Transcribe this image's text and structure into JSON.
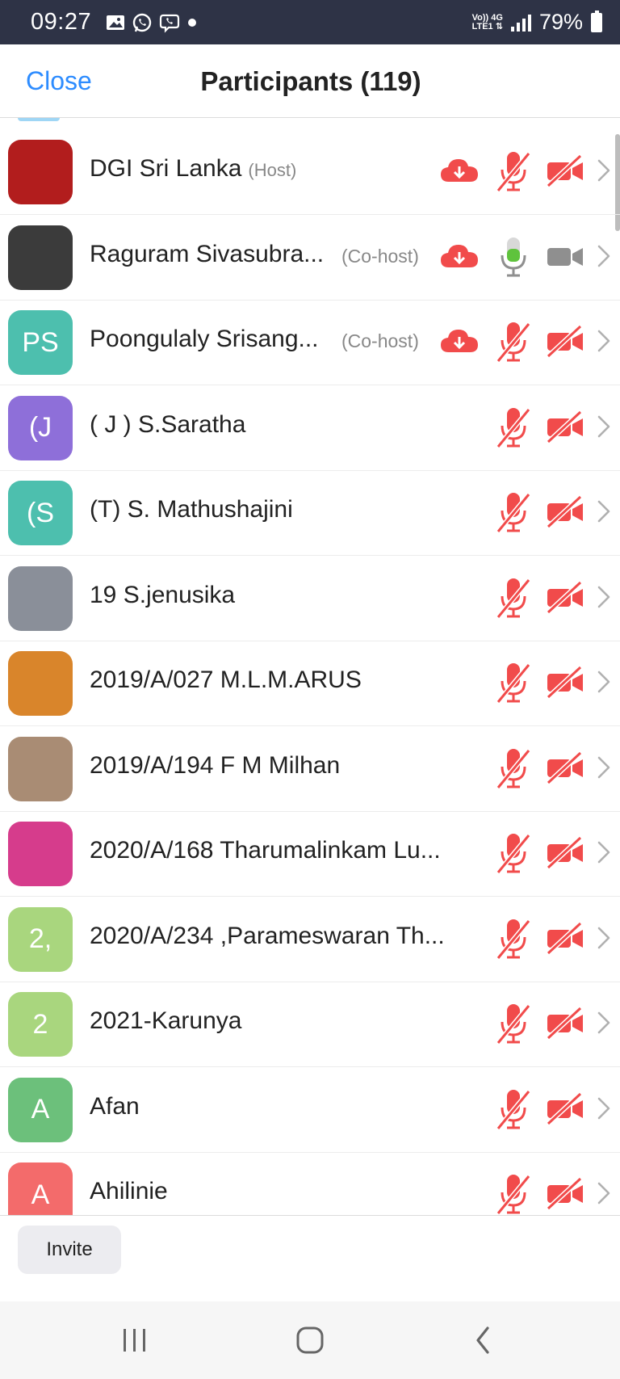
{
  "status_bar": {
    "time": "09:27",
    "network_line1": "Vo)) 4G",
    "network_line2": "LTE1 ⇅",
    "battery": "79%",
    "icons": [
      "gallery-icon",
      "whatsapp-icon",
      "viber-icon",
      "dot-icon"
    ]
  },
  "header": {
    "close_label": "Close",
    "title": "Participants (119)"
  },
  "participants": [
    {
      "name": "DGI Sri Lanka",
      "role": "(Host)",
      "avatar_text": "",
      "avatar_color": "#b21d1d",
      "cloud": true,
      "mic": "muted",
      "video": "off"
    },
    {
      "name": "Raguram Sivasubra...",
      "role": "(Co-host)",
      "avatar_text": "",
      "avatar_color": "#3b3b3b",
      "cloud": true,
      "mic": "on",
      "video": "on"
    },
    {
      "name": "Poongulaly Srisang...",
      "role": "(Co-host)",
      "avatar_text": "PS",
      "avatar_color": "#4dbfae",
      "cloud": true,
      "mic": "muted",
      "video": "off"
    },
    {
      "name": "( J ) S.Saratha",
      "role": "",
      "avatar_text": "(J",
      "avatar_color": "#8e6fd9",
      "cloud": false,
      "mic": "muted",
      "video": "off"
    },
    {
      "name": "(T) S. Mathushajini",
      "role": "",
      "avatar_text": "(S",
      "avatar_color": "#4dbfae",
      "cloud": false,
      "mic": "muted",
      "video": "off"
    },
    {
      "name": "19 S.jenusika",
      "role": "",
      "avatar_text": "",
      "avatar_color": "#8a8f99",
      "cloud": false,
      "mic": "muted",
      "video": "off"
    },
    {
      "name": "2019/A/027 M.L.M.ARUS",
      "role": "",
      "avatar_text": "",
      "avatar_color": "#d9852b",
      "cloud": false,
      "mic": "muted",
      "video": "off"
    },
    {
      "name": "2019/A/194 F M Milhan",
      "role": "",
      "avatar_text": "",
      "avatar_color": "#a98c74",
      "cloud": false,
      "mic": "muted",
      "video": "off"
    },
    {
      "name": "2020/A/168 Tharumalinkam Lu...",
      "role": "",
      "avatar_text": "",
      "avatar_color": "#d63c8c",
      "cloud": false,
      "mic": "muted",
      "video": "off"
    },
    {
      "name": "2020/A/234 ,Parameswaran Th...",
      "role": "",
      "avatar_text": "2,",
      "avatar_color": "#a9d67e",
      "cloud": false,
      "mic": "muted",
      "video": "off"
    },
    {
      "name": "2021-Karunya",
      "role": "",
      "avatar_text": "2",
      "avatar_color": "#a9d67e",
      "cloud": false,
      "mic": "muted",
      "video": "off"
    },
    {
      "name": "Afan",
      "role": "",
      "avatar_text": "A",
      "avatar_color": "#6cc07b",
      "cloud": false,
      "mic": "muted",
      "video": "off"
    },
    {
      "name": "Ahilinie",
      "role": "",
      "avatar_text": "A",
      "avatar_color": "#f36b6b",
      "cloud": false,
      "mic": "muted",
      "video": "off"
    }
  ],
  "footer": {
    "invite_label": "Invite"
  },
  "nav_bar": {
    "icons": [
      "recent-apps-icon",
      "home-icon",
      "back-icon"
    ]
  },
  "colors": {
    "accent": "#2d8cff",
    "muted_red": "#f14b4b",
    "mic_on_green": "#5fc33c",
    "video_on_gray": "#8f8f8f"
  }
}
